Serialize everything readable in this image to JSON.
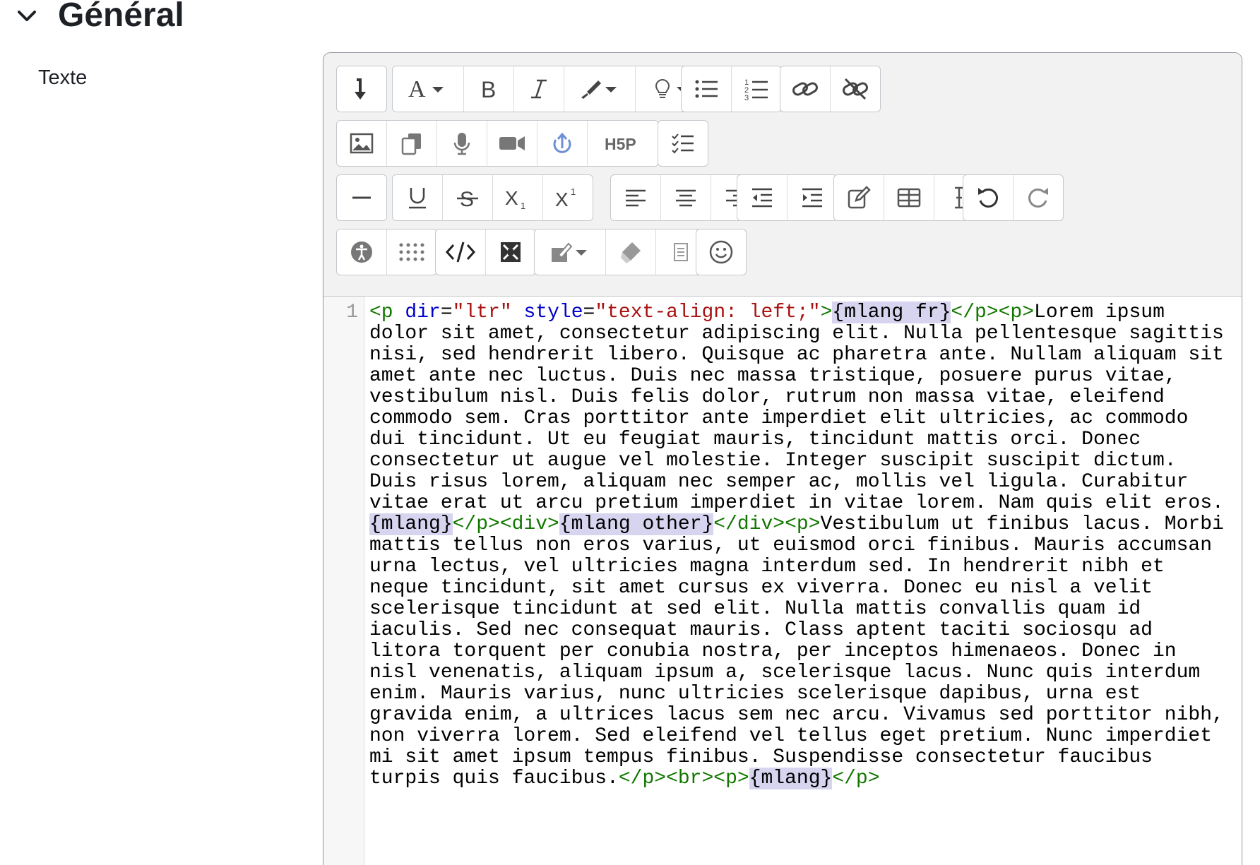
{
  "section": {
    "title": "Général",
    "collapse_icon": "chevron-down-icon"
  },
  "field": {
    "label": "Texte"
  },
  "toolbar": {
    "rows": [
      [
        [
          "collapse"
        ],
        [
          "font-style",
          "bold",
          "italic",
          "text-color",
          "background-color"
        ],
        [
          "unordered-list",
          "ordered-list"
        ],
        [
          "link",
          "unlink"
        ]
      ],
      [
        [
          "image",
          "media-manage",
          "record-audio",
          "record-video",
          "upload",
          "h5p"
        ],
        [
          "checklist"
        ]
      ],
      [
        [
          "horizontal-rule"
        ],
        [
          "underline",
          "strikethrough",
          "subscript",
          "superscript"
        ],
        [
          "align-left",
          "align-center",
          "align-right"
        ],
        [
          "outdent",
          "indent"
        ],
        [
          "equation",
          "table",
          "special-char"
        ],
        [
          "undo",
          "redo"
        ]
      ],
      [
        [
          "accessibility-checker",
          "screen-reader-helper"
        ],
        [
          "html-source",
          "fullscreen"
        ],
        [
          "paste-special",
          "clear-formatting",
          "paste-word"
        ],
        [
          "emoji"
        ]
      ]
    ]
  },
  "code_editor": {
    "line_number": "1",
    "tokens": {
      "t01": "<p ",
      "t02": "dir",
      "t03": "=",
      "t04": "\"ltr\"",
      "t05": " ",
      "t06": "style",
      "t07": "=",
      "t08": "\"text-align: left;\"",
      "t09": ">",
      "t10": "{mlang fr}",
      "t11": "</p><p>",
      "t12": "Lorem ipsum dolor sit amet, consectetur adipiscing elit. Nulla pellentesque sagittis nisi, sed hendrerit libero. Quisque ac pharetra ante. Nullam aliquam sit amet ante nec luctus. Duis nec massa tristique, posuere purus vitae, vestibulum nisl. Duis felis dolor, rutrum non massa vitae, eleifend commodo sem. Cras porttitor ante imperdiet elit ultricies, ac commodo dui tincidunt. Ut eu feugiat mauris, tincidunt mattis orci. Donec consectetur ut augue vel molestie. Integer suscipit suscipit dictum. Duis risus lorem, aliquam nec semper ac, mollis vel ligula. Curabitur vitae erat ut arcu pretium imperdiet in vitae lorem. Nam quis elit eros.",
      "t13": "{mlang}",
      "t14": "</p><div>",
      "t15": "{mlang other}",
      "t16": "</div><p>",
      "t17": "Vestibulum ut finibus lacus. Morbi mattis tellus non eros varius, ut euismod orci finibus. Mauris accumsan urna lectus, vel ultricies magna interdum sed. In hendrerit nibh et neque tincidunt, sit amet cursus ex viverra. Donec eu nisl a velit scelerisque tincidunt at sed elit. Nulla mattis convallis quam id iaculis. Sed nec consequat mauris. Class aptent taciti sociosqu ad litora torquent per conubia nostra, per inceptos himenaeos. Donec in nisl venenatis, aliquam ipsum a, scelerisque lacus. Nunc quis interdum enim. Mauris varius, nunc ultricies scelerisque dapibus, urna est gravida enim, a ultrices lacus sem nec arcu. Vivamus sed porttitor nibh, non viverra lorem. Sed eleifend vel tellus eget pretium. Nunc imperdiet mi sit amet ipsum tempus finibus. Suspendisse consectetur faucibus turpis quis faucibus.",
      "t18": "</p><br><p>",
      "t19": "{mlang}",
      "t20": "</p>"
    }
  },
  "colors": {
    "tag": "#117700",
    "attribute": "#0000cc",
    "string": "#aa1111",
    "highlight": "#d7d4f0",
    "toolbar_bg": "#f2f2f2"
  }
}
